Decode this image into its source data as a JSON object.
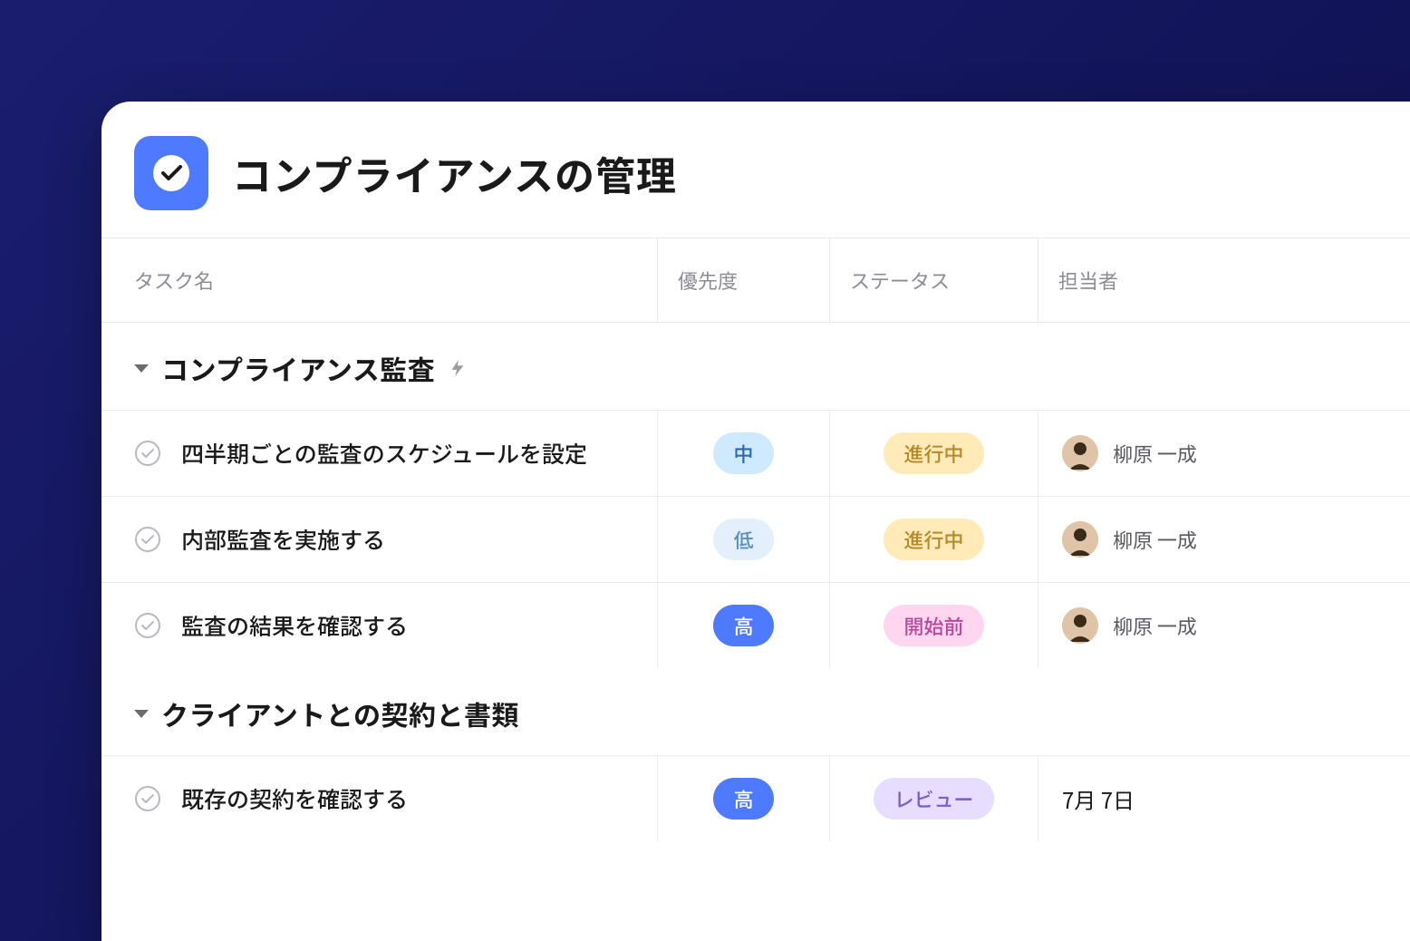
{
  "header": {
    "title": "コンプライアンスの管理"
  },
  "columns": {
    "task": "タスク名",
    "priority": "優先度",
    "status": "ステータス",
    "assignee": "担当者"
  },
  "sections": [
    {
      "title": "コンプライアンス監査",
      "has_automation": true,
      "rows": [
        {
          "task": "四半期ごとの監査のスケジュールを設定",
          "priority": "中",
          "priority_class": "medium",
          "status": "進行中",
          "status_class": "progress",
          "assignee": "柳原 一成"
        },
        {
          "task": "内部監査を実施する",
          "priority": "低",
          "priority_class": "low",
          "status": "進行中",
          "status_class": "progress",
          "assignee": "柳原 一成"
        },
        {
          "task": "監査の結果を確認する",
          "priority": "高",
          "priority_class": "high",
          "status": "開始前",
          "status_class": "notstarted",
          "assignee": "柳原 一成"
        }
      ]
    },
    {
      "title": "クライアントとの契約と書類",
      "has_automation": false,
      "rows": [
        {
          "task": "既存の契約を確認する",
          "priority": "高",
          "priority_class": "high",
          "status": "レビュー",
          "status_class": "review",
          "date": "7月 7日"
        }
      ]
    }
  ]
}
